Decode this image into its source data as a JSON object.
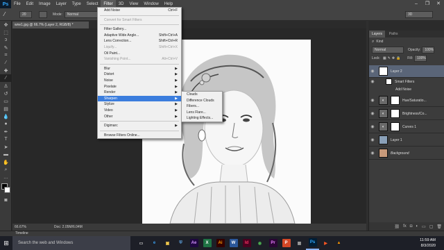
{
  "app": {
    "logo": "Ps",
    "menus": [
      "File",
      "Edit",
      "Image",
      "Layer",
      "Type",
      "Select",
      "Filter",
      "3D",
      "View",
      "Window",
      "Help"
    ],
    "active_menu": "Filter",
    "window_controls": [
      "–",
      "❐",
      "✕"
    ]
  },
  "options_bar": {
    "brush_size": "20",
    "mode_label": "Mode:",
    "mode_value": "Normal",
    "workspace_value": "3D"
  },
  "document": {
    "tab_title": "wne1.jpg @ 66.7% (Layer 2, RGB/8) *",
    "zoom": "66.67%",
    "doc_info": "Doc: 2.05M/6.04M"
  },
  "filter_menu": {
    "items": [
      {
        "label": "Add Noise",
        "shortcut": "Ctrl+F",
        "disabled": false,
        "submenu": false
      },
      {
        "sep": true
      },
      {
        "label": "Convert for Smart Filters",
        "shortcut": "",
        "disabled": true,
        "submenu": false
      },
      {
        "sep": true
      },
      {
        "label": "Filter Gallery...",
        "shortcut": "",
        "disabled": false,
        "submenu": false
      },
      {
        "label": "Adaptive Wide Angle...",
        "shortcut": "Shift+Ctrl+A",
        "disabled": false,
        "submenu": false
      },
      {
        "label": "Lens Correction...",
        "shortcut": "Shift+Ctrl+R",
        "disabled": false,
        "submenu": false
      },
      {
        "label": "Liquify...",
        "shortcut": "Shift+Ctrl+X",
        "disabled": true,
        "submenu": false
      },
      {
        "label": "Oil Paint...",
        "shortcut": "",
        "disabled": false,
        "submenu": false
      },
      {
        "label": "Vanishing Point...",
        "shortcut": "Alt+Ctrl+V",
        "disabled": true,
        "submenu": false
      },
      {
        "sep": true
      },
      {
        "label": "Blur",
        "shortcut": "",
        "disabled": false,
        "submenu": true
      },
      {
        "label": "Distort",
        "shortcut": "",
        "disabled": false,
        "submenu": true
      },
      {
        "label": "Noise",
        "shortcut": "",
        "disabled": false,
        "submenu": true
      },
      {
        "label": "Pixelate",
        "shortcut": "",
        "disabled": false,
        "submenu": true
      },
      {
        "label": "Render",
        "shortcut": "",
        "disabled": false,
        "submenu": true
      },
      {
        "label": "Sharpen",
        "shortcut": "",
        "disabled": false,
        "submenu": true,
        "highlighted": true
      },
      {
        "label": "Stylize",
        "shortcut": "",
        "disabled": false,
        "submenu": true
      },
      {
        "label": "Video",
        "shortcut": "",
        "disabled": false,
        "submenu": true
      },
      {
        "label": "Other",
        "shortcut": "",
        "disabled": false,
        "submenu": true
      },
      {
        "sep": true
      },
      {
        "label": "Digimarc",
        "shortcut": "",
        "disabled": false,
        "submenu": true
      },
      {
        "sep": true
      },
      {
        "label": "Browse Filters Online...",
        "shortcut": "",
        "disabled": false,
        "submenu": false
      }
    ]
  },
  "render_submenu": {
    "items": [
      "Clouds",
      "Difference Clouds",
      "Fibers...",
      "Lens Flare...",
      "Lighting Effects..."
    ]
  },
  "layers_panel": {
    "tabs": [
      "Layers",
      "Paths"
    ],
    "kind_label": "Kind",
    "blend_mode": "Normal",
    "opacity_label": "Opacity:",
    "opacity_value": "100%",
    "lock_label": "Lock:",
    "fill_label": "Fill:",
    "fill_value": "100%",
    "layers": [
      {
        "name": "Layer 2",
        "type": "smart",
        "selected": true
      },
      {
        "name": "Smart Filters",
        "type": "smart-filters"
      },
      {
        "name": "Add Noise",
        "type": "filter"
      },
      {
        "name": "Hue/Saturatio...",
        "type": "adjustment",
        "icon": "hue-icon"
      },
      {
        "name": "Brightness/Co...",
        "type": "adjustment",
        "icon": "brightness-icon"
      },
      {
        "name": "Curves 1",
        "type": "adjustment",
        "icon": "curves-icon"
      },
      {
        "name": "Layer 1",
        "type": "pixel"
      },
      {
        "name": "Background",
        "type": "pixel"
      }
    ]
  },
  "timeline_label": "Timeline",
  "taskbar": {
    "search_placeholder": "Search the web and Windows",
    "apps": [
      {
        "label": "▭",
        "color": "#c9c9c9",
        "bg": "transparent"
      },
      {
        "label": "e",
        "color": "#3aa0f0",
        "bg": "transparent"
      },
      {
        "label": "▣",
        "color": "#f2c94c",
        "bg": "transparent"
      },
      {
        "label": "⛨",
        "color": "#5b9bd5",
        "bg": "transparent"
      },
      {
        "label": "Ae",
        "color": "#d291ff",
        "bg": "#1f0740"
      },
      {
        "label": "X",
        "color": "#fff",
        "bg": "#1f7244"
      },
      {
        "label": "Ai",
        "color": "#ff9a00",
        "bg": "#330000"
      },
      {
        "label": "W",
        "color": "#fff",
        "bg": "#2b579a"
      },
      {
        "label": "Id",
        "color": "#ff3366",
        "bg": "#49021f"
      },
      {
        "label": "◉",
        "color": "#4caf50",
        "bg": "transparent"
      },
      {
        "label": "Pr",
        "color": "#e77cff",
        "bg": "#2a0634"
      },
      {
        "label": "P",
        "color": "#fff",
        "bg": "#d24726"
      },
      {
        "label": "▦",
        "color": "#a0a0a0",
        "bg": "transparent"
      },
      {
        "label": "Ps",
        "color": "#31a8ff",
        "bg": "#001e36"
      },
      {
        "label": "▶",
        "color": "#ff5722",
        "bg": "transparent"
      },
      {
        "label": "▲",
        "color": "#ff9800",
        "bg": "transparent"
      }
    ],
    "time": "11:59 AM",
    "date": "8/3/2020"
  }
}
